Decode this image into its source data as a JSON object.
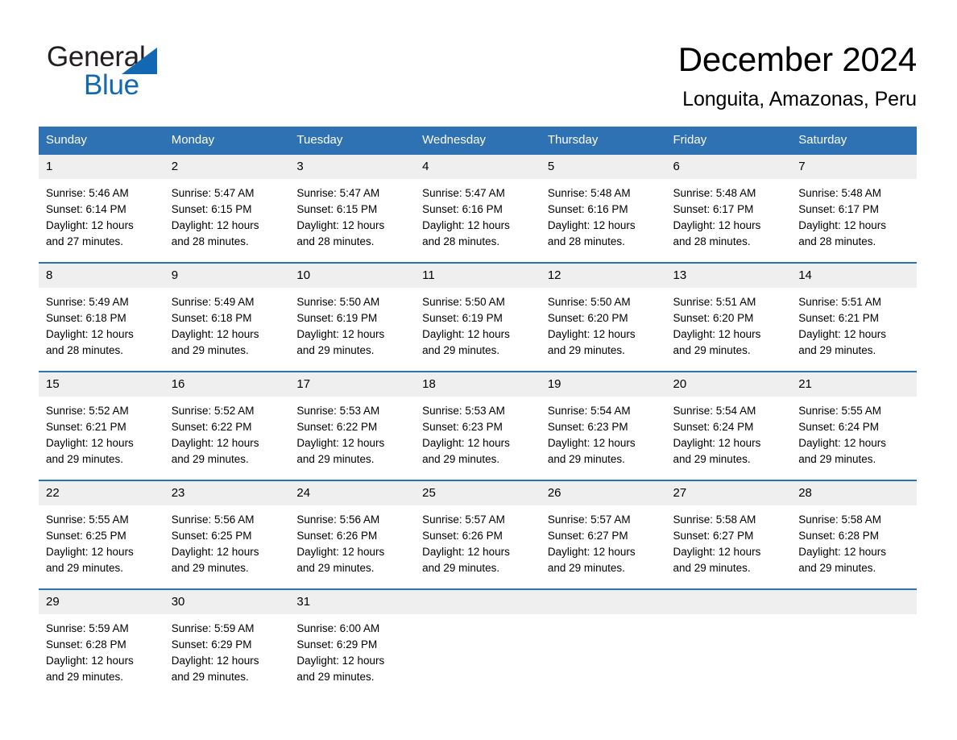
{
  "brand": {
    "name_part1": "General",
    "name_part2": "Blue",
    "accent_color": "#1268b3"
  },
  "header": {
    "title": "December 2024",
    "subtitle": "Longuita, Amazonas, Peru"
  },
  "theme": {
    "header_blue": "#2f72b4",
    "daynum_gray": "#efefef",
    "text_black": "#000000"
  },
  "weekdays": [
    "Sunday",
    "Monday",
    "Tuesday",
    "Wednesday",
    "Thursday",
    "Friday",
    "Saturday"
  ],
  "weeks": [
    [
      {
        "day": "1",
        "sunrise": "Sunrise: 5:46 AM",
        "sunset": "Sunset: 6:14 PM",
        "daylight_line1": "Daylight: 12 hours",
        "daylight_line2": "and 27 minutes."
      },
      {
        "day": "2",
        "sunrise": "Sunrise: 5:47 AM",
        "sunset": "Sunset: 6:15 PM",
        "daylight_line1": "Daylight: 12 hours",
        "daylight_line2": "and 28 minutes."
      },
      {
        "day": "3",
        "sunrise": "Sunrise: 5:47 AM",
        "sunset": "Sunset: 6:15 PM",
        "daylight_line1": "Daylight: 12 hours",
        "daylight_line2": "and 28 minutes."
      },
      {
        "day": "4",
        "sunrise": "Sunrise: 5:47 AM",
        "sunset": "Sunset: 6:16 PM",
        "daylight_line1": "Daylight: 12 hours",
        "daylight_line2": "and 28 minutes."
      },
      {
        "day": "5",
        "sunrise": "Sunrise: 5:48 AM",
        "sunset": "Sunset: 6:16 PM",
        "daylight_line1": "Daylight: 12 hours",
        "daylight_line2": "and 28 minutes."
      },
      {
        "day": "6",
        "sunrise": "Sunrise: 5:48 AM",
        "sunset": "Sunset: 6:17 PM",
        "daylight_line1": "Daylight: 12 hours",
        "daylight_line2": "and 28 minutes."
      },
      {
        "day": "7",
        "sunrise": "Sunrise: 5:48 AM",
        "sunset": "Sunset: 6:17 PM",
        "daylight_line1": "Daylight: 12 hours",
        "daylight_line2": "and 28 minutes."
      }
    ],
    [
      {
        "day": "8",
        "sunrise": "Sunrise: 5:49 AM",
        "sunset": "Sunset: 6:18 PM",
        "daylight_line1": "Daylight: 12 hours",
        "daylight_line2": "and 28 minutes."
      },
      {
        "day": "9",
        "sunrise": "Sunrise: 5:49 AM",
        "sunset": "Sunset: 6:18 PM",
        "daylight_line1": "Daylight: 12 hours",
        "daylight_line2": "and 29 minutes."
      },
      {
        "day": "10",
        "sunrise": "Sunrise: 5:50 AM",
        "sunset": "Sunset: 6:19 PM",
        "daylight_line1": "Daylight: 12 hours",
        "daylight_line2": "and 29 minutes."
      },
      {
        "day": "11",
        "sunrise": "Sunrise: 5:50 AM",
        "sunset": "Sunset: 6:19 PM",
        "daylight_line1": "Daylight: 12 hours",
        "daylight_line2": "and 29 minutes."
      },
      {
        "day": "12",
        "sunrise": "Sunrise: 5:50 AM",
        "sunset": "Sunset: 6:20 PM",
        "daylight_line1": "Daylight: 12 hours",
        "daylight_line2": "and 29 minutes."
      },
      {
        "day": "13",
        "sunrise": "Sunrise: 5:51 AM",
        "sunset": "Sunset: 6:20 PM",
        "daylight_line1": "Daylight: 12 hours",
        "daylight_line2": "and 29 minutes."
      },
      {
        "day": "14",
        "sunrise": "Sunrise: 5:51 AM",
        "sunset": "Sunset: 6:21 PM",
        "daylight_line1": "Daylight: 12 hours",
        "daylight_line2": "and 29 minutes."
      }
    ],
    [
      {
        "day": "15",
        "sunrise": "Sunrise: 5:52 AM",
        "sunset": "Sunset: 6:21 PM",
        "daylight_line1": "Daylight: 12 hours",
        "daylight_line2": "and 29 minutes."
      },
      {
        "day": "16",
        "sunrise": "Sunrise: 5:52 AM",
        "sunset": "Sunset: 6:22 PM",
        "daylight_line1": "Daylight: 12 hours",
        "daylight_line2": "and 29 minutes."
      },
      {
        "day": "17",
        "sunrise": "Sunrise: 5:53 AM",
        "sunset": "Sunset: 6:22 PM",
        "daylight_line1": "Daylight: 12 hours",
        "daylight_line2": "and 29 minutes."
      },
      {
        "day": "18",
        "sunrise": "Sunrise: 5:53 AM",
        "sunset": "Sunset: 6:23 PM",
        "daylight_line1": "Daylight: 12 hours",
        "daylight_line2": "and 29 minutes."
      },
      {
        "day": "19",
        "sunrise": "Sunrise: 5:54 AM",
        "sunset": "Sunset: 6:23 PM",
        "daylight_line1": "Daylight: 12 hours",
        "daylight_line2": "and 29 minutes."
      },
      {
        "day": "20",
        "sunrise": "Sunrise: 5:54 AM",
        "sunset": "Sunset: 6:24 PM",
        "daylight_line1": "Daylight: 12 hours",
        "daylight_line2": "and 29 minutes."
      },
      {
        "day": "21",
        "sunrise": "Sunrise: 5:55 AM",
        "sunset": "Sunset: 6:24 PM",
        "daylight_line1": "Daylight: 12 hours",
        "daylight_line2": "and 29 minutes."
      }
    ],
    [
      {
        "day": "22",
        "sunrise": "Sunrise: 5:55 AM",
        "sunset": "Sunset: 6:25 PM",
        "daylight_line1": "Daylight: 12 hours",
        "daylight_line2": "and 29 minutes."
      },
      {
        "day": "23",
        "sunrise": "Sunrise: 5:56 AM",
        "sunset": "Sunset: 6:25 PM",
        "daylight_line1": "Daylight: 12 hours",
        "daylight_line2": "and 29 minutes."
      },
      {
        "day": "24",
        "sunrise": "Sunrise: 5:56 AM",
        "sunset": "Sunset: 6:26 PM",
        "daylight_line1": "Daylight: 12 hours",
        "daylight_line2": "and 29 minutes."
      },
      {
        "day": "25",
        "sunrise": "Sunrise: 5:57 AM",
        "sunset": "Sunset: 6:26 PM",
        "daylight_line1": "Daylight: 12 hours",
        "daylight_line2": "and 29 minutes."
      },
      {
        "day": "26",
        "sunrise": "Sunrise: 5:57 AM",
        "sunset": "Sunset: 6:27 PM",
        "daylight_line1": "Daylight: 12 hours",
        "daylight_line2": "and 29 minutes."
      },
      {
        "day": "27",
        "sunrise": "Sunrise: 5:58 AM",
        "sunset": "Sunset: 6:27 PM",
        "daylight_line1": "Daylight: 12 hours",
        "daylight_line2": "and 29 minutes."
      },
      {
        "day": "28",
        "sunrise": "Sunrise: 5:58 AM",
        "sunset": "Sunset: 6:28 PM",
        "daylight_line1": "Daylight: 12 hours",
        "daylight_line2": "and 29 minutes."
      }
    ],
    [
      {
        "day": "29",
        "sunrise": "Sunrise: 5:59 AM",
        "sunset": "Sunset: 6:28 PM",
        "daylight_line1": "Daylight: 12 hours",
        "daylight_line2": "and 29 minutes."
      },
      {
        "day": "30",
        "sunrise": "Sunrise: 5:59 AM",
        "sunset": "Sunset: 6:29 PM",
        "daylight_line1": "Daylight: 12 hours",
        "daylight_line2": "and 29 minutes."
      },
      {
        "day": "31",
        "sunrise": "Sunrise: 6:00 AM",
        "sunset": "Sunset: 6:29 PM",
        "daylight_line1": "Daylight: 12 hours",
        "daylight_line2": "and 29 minutes."
      },
      {
        "day": "",
        "sunrise": "",
        "sunset": "",
        "daylight_line1": "",
        "daylight_line2": ""
      },
      {
        "day": "",
        "sunrise": "",
        "sunset": "",
        "daylight_line1": "",
        "daylight_line2": ""
      },
      {
        "day": "",
        "sunrise": "",
        "sunset": "",
        "daylight_line1": "",
        "daylight_line2": ""
      },
      {
        "day": "",
        "sunrise": "",
        "sunset": "",
        "daylight_line1": "",
        "daylight_line2": ""
      }
    ]
  ]
}
